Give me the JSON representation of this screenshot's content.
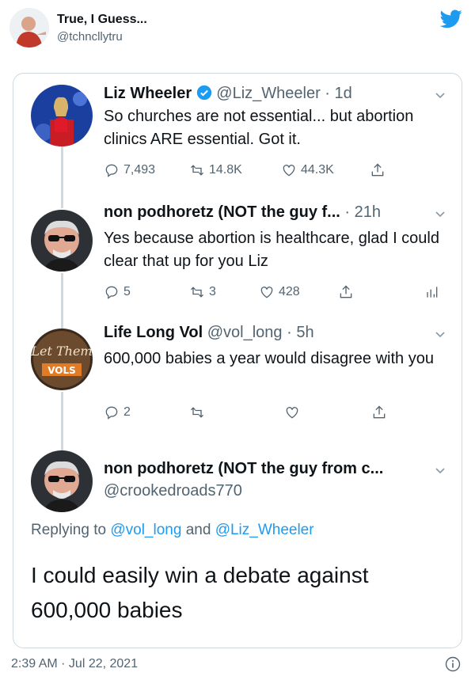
{
  "outer": {
    "name": "True, I Guess...",
    "handle": "@tchncllytru",
    "date": "2:39 AM · Jul 22, 2021",
    "brand_color": "#1d9bf0"
  },
  "tweets": [
    {
      "name": "Liz Wheeler",
      "handle": "@Liz_Wheeler",
      "time": "· 1d",
      "verified": true,
      "text": "So churches are not essential... but abortion clinics ARE essential. Got it.",
      "replies": "7,493",
      "retweets": "14.8K",
      "likes": "44.3K"
    },
    {
      "name": "non podhoretz (NOT the guy f...",
      "time": "· 21h",
      "text": "Yes because abortion is healthcare, glad I could clear that up for you Liz",
      "replies": "5",
      "retweets": "3",
      "likes": "428"
    },
    {
      "name": "Life Long Vol",
      "handle": "@vol_long",
      "time": "· 5h",
      "text": "600,000 babies a year would disagree with you",
      "replies": "2",
      "retweets": "",
      "likes": ""
    },
    {
      "name": "non podhoretz (NOT the guy from c...",
      "handle": "@crookedroads770"
    }
  ],
  "reply": {
    "prefix": "Replying to",
    "mention1": "@vol_long",
    "and": "and",
    "mention2": "@Liz_Wheeler",
    "text": "I could easily win a debate against 600,000 babies"
  },
  "icons": [
    "twitter-bird-icon",
    "verified-badge-icon",
    "chevron-down-icon",
    "reply-icon",
    "retweet-icon",
    "like-icon",
    "share-icon",
    "analytics-icon",
    "info-icon"
  ]
}
